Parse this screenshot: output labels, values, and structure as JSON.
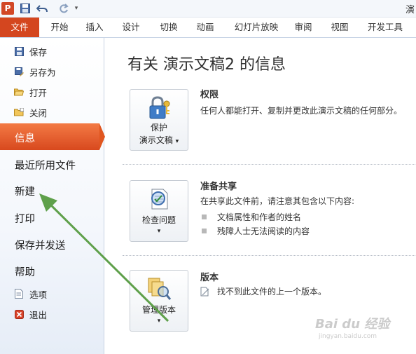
{
  "app": {
    "logo_letter": "P",
    "window_title_fragment": "演"
  },
  "qat": {
    "save_icon": "save-icon",
    "undo_icon": "undo-icon",
    "redo_icon": "redo-icon",
    "dropdown_icon": "customize-qat-icon"
  },
  "tabs": [
    {
      "id": "file",
      "label": "文件",
      "active": true
    },
    {
      "id": "home",
      "label": "开始"
    },
    {
      "id": "insert",
      "label": "插入"
    },
    {
      "id": "design",
      "label": "设计"
    },
    {
      "id": "transitions",
      "label": "切换"
    },
    {
      "id": "animations",
      "label": "动画"
    },
    {
      "id": "slideshow",
      "label": "幻灯片放映"
    },
    {
      "id": "review",
      "label": "审阅"
    },
    {
      "id": "view",
      "label": "视图"
    },
    {
      "id": "developer",
      "label": "开发工具"
    }
  ],
  "sidebar": {
    "commands": [
      {
        "id": "save",
        "label": "保存",
        "icon": "save-icon"
      },
      {
        "id": "save-as",
        "label": "另存为",
        "icon": "save-as-icon"
      },
      {
        "id": "open",
        "label": "打开",
        "icon": "open-folder-icon"
      },
      {
        "id": "close",
        "label": "关闭",
        "icon": "close-folder-icon"
      }
    ],
    "info": "信息",
    "recent": "最近所用文件",
    "new": "新建",
    "print": "打印",
    "save_send": "保存并发送",
    "help": "帮助",
    "options": "选项",
    "exit": "退出"
  },
  "main": {
    "title": "有关 演示文稿2 的信息",
    "permissions": {
      "button_line1": "保护",
      "button_line2": "演示文稿",
      "dropdown": "▾",
      "heading": "权限",
      "description": "任何人都能打开、复制并更改此演示文稿的任何部分。"
    },
    "prepare": {
      "button_label": "检查问题",
      "dropdown": "▾",
      "heading": "准备共享",
      "description": "在共享此文件前，请注意其包含以下内容:",
      "items": [
        "文档属性和作者的姓名",
        "残障人士无法阅读的内容"
      ]
    },
    "versions": {
      "button_label": "管理版本",
      "dropdown": "▾",
      "heading": "版本",
      "description": "找不到此文件的上一个版本。"
    }
  },
  "watermark": {
    "brand": "Bai du 经验",
    "url": "jingyan.baidu.com"
  },
  "colors": {
    "file_tab": "#d4461f",
    "active_nav": "#e0561f",
    "annotation_arrow": "#5fa04b"
  }
}
